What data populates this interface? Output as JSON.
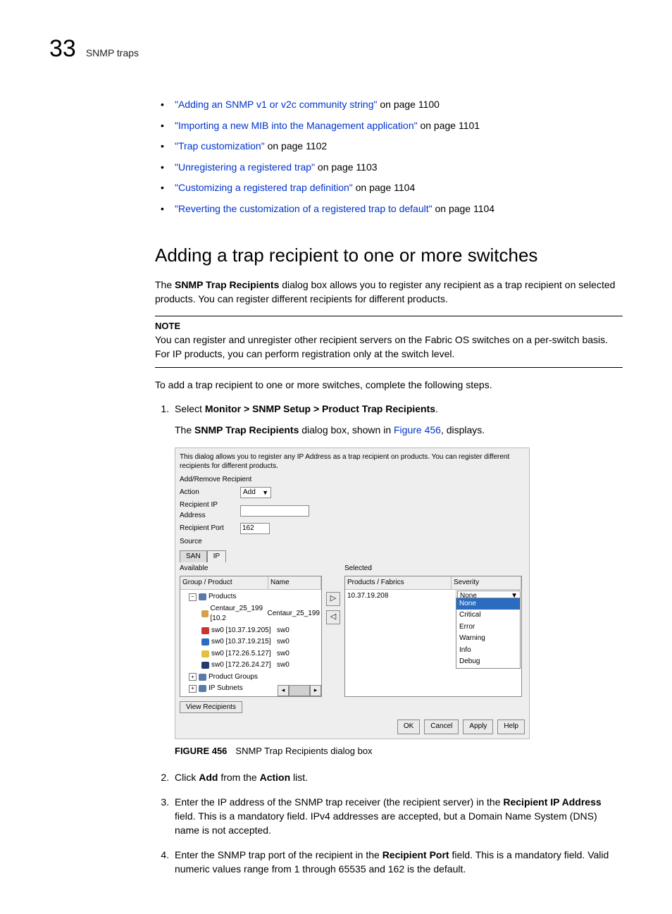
{
  "header": {
    "page_number": "33",
    "section": "SNMP traps"
  },
  "links": [
    {
      "text": "\"Adding an SNMP v1 or v2c community string\"",
      "suffix": " on page 1100"
    },
    {
      "text": "\"Importing a new MIB into the Management application\"",
      "suffix": " on page 1101"
    },
    {
      "text": "\"Trap customization\"",
      "suffix": " on page 1102"
    },
    {
      "text": "\"Unregistering a registered trap\"",
      "suffix": " on page 1103"
    },
    {
      "text": "\"Customizing a registered trap definition\"",
      "suffix": " on page 1104"
    },
    {
      "text": "\"Reverting the customization of a registered trap to default\"",
      "suffix": " on page 1104"
    }
  ],
  "heading": "Adding a trap recipient to one or more switches",
  "intro": {
    "pre": "The ",
    "bold": "SNMP Trap Recipients",
    "post": " dialog box allows you to register any recipient as a trap recipient on selected products. You can register different recipients for different products."
  },
  "note": {
    "label": "NOTE",
    "body": "You can register and unregister other recipient servers on the Fabric OS switches on a per-switch basis. For IP products, you can perform registration only at the switch level."
  },
  "lead": "To add a trap recipient to one or more switches, complete the following steps.",
  "step1": {
    "pre": "Select ",
    "bold": "Monitor > SNMP Setup > Product Trap Recipients",
    "post": ".",
    "line2_pre": "The ",
    "line2_bold": "SNMP Trap Recipients",
    "line2_mid": " dialog box, shown in ",
    "line2_link": "Figure 456",
    "line2_post": ", displays."
  },
  "dialog": {
    "desc": "This dialog allows you to register any IP Address as a trap recipient on products. You can register different recipients for different products.",
    "section_label": "Add/Remove Recipient",
    "action_label": "Action",
    "action_value": "Add",
    "ip_label": "Recipient IP Address",
    "ip_value": "",
    "port_label": "Recipient Port",
    "port_value": "162",
    "source_label": "Source",
    "tabs": {
      "san": "SAN",
      "ip": "IP"
    },
    "available_label": "Available",
    "selected_label": "Selected",
    "left_cols": {
      "group": "Group / Product",
      "name": "Name"
    },
    "right_cols": {
      "product": "Products / Fabrics",
      "severity": "Severity"
    },
    "tree": {
      "root": "Products",
      "items": [
        {
          "label": "Centaur_25_199 [10.2",
          "name": "Centaur_25_199",
          "icon": "fabric"
        },
        {
          "label": "sw0 [10.37.19.205]",
          "name": "sw0",
          "icon": "sw-red"
        },
        {
          "label": "sw0 [10.37.19.215]",
          "name": "sw0",
          "icon": "sw-blue"
        },
        {
          "label": "sw0 [172.26.5.127]",
          "name": "sw0",
          "icon": "sw-yellow"
        },
        {
          "label": "sw0 [172.26.24.27]",
          "name": "sw0",
          "icon": "sw-navy"
        }
      ],
      "groups": "Product Groups",
      "subnets": "IP Subnets"
    },
    "selected_row": {
      "product": "10.37.19.208",
      "severity": "None"
    },
    "severity_options": [
      "None",
      "Critical",
      "Error",
      "Warning",
      "Info",
      "Debug"
    ],
    "view_recipients": "View Recipients",
    "buttons": {
      "ok": "OK",
      "cancel": "Cancel",
      "apply": "Apply",
      "help": "Help"
    }
  },
  "figure": {
    "label": "FIGURE 456",
    "caption": "SNMP Trap Recipients dialog box"
  },
  "step2": {
    "pre": "Click ",
    "b1": "Add",
    "mid": " from the ",
    "b2": "Action",
    "post": " list."
  },
  "step3": {
    "pre": "Enter the IP address of the SNMP trap receiver (the recipient server) in the ",
    "b1": "Recipient IP Address",
    "post": " field. This is a mandatory field. IPv4 addresses are accepted, but a Domain Name System (DNS) name is not accepted."
  },
  "step4": {
    "pre": "Enter the SNMP trap port of the recipient in the ",
    "b1": "Recipient Port",
    "post": " field. This is a mandatory field. Valid numeric values range from 1 through 65535 and 162 is the default."
  }
}
